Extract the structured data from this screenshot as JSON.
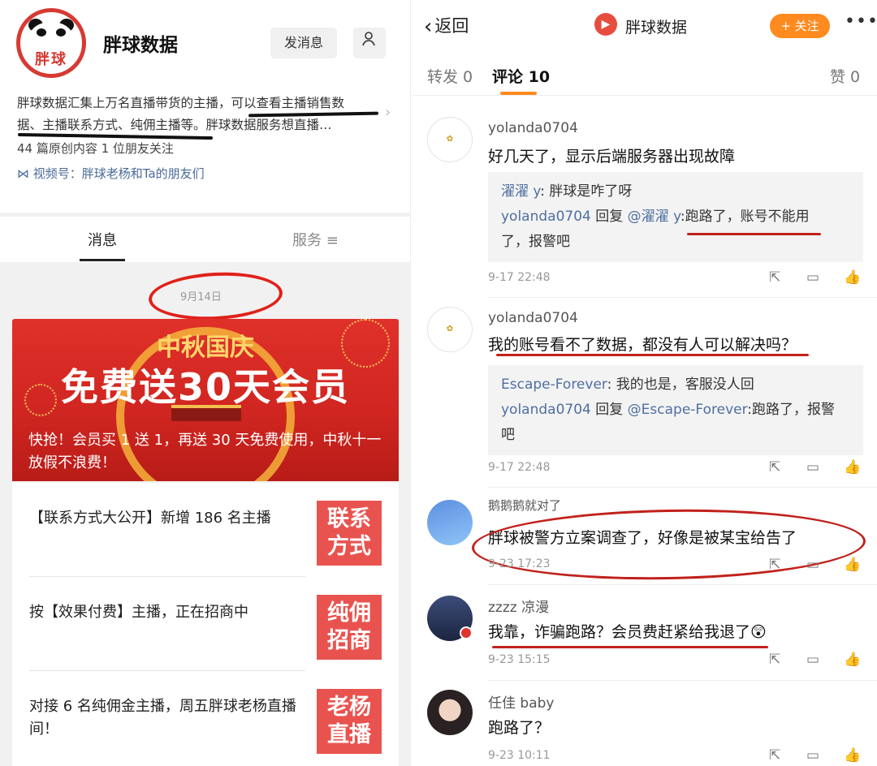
{
  "left": {
    "profile": {
      "logo_text": "胖球",
      "name": "胖球数据",
      "message_button": "发消息",
      "description_line1": "胖球数据汇集上万名直播带货的主播，可以查看主播销售数",
      "description_line2": "据、主播联系方式、纯佣主播等。胖球数据服务想直播…",
      "stats": "44 篇原创内容  1 位朋友关注",
      "channel": "视频号：胖球老杨和Ta的朋友们"
    },
    "tabs": {
      "messages": "消息",
      "services": "服务 ≡"
    },
    "date_label": "9月14日",
    "banner": {
      "title_top": "中秋国庆",
      "title_main": "免费送30天会员",
      "caption": "快抢！会员买 1 送 1，再送 30 天免费使用，中秋十一放假不浪费！"
    },
    "articles": [
      {
        "text": "【联系方式大公开】新增 186 名主播",
        "thumb_line1": "联系",
        "thumb_line2": "方式"
      },
      {
        "text": "按【效果付费】主播，正在招商中",
        "thumb_line1": "纯佣",
        "thumb_line2": "招商"
      },
      {
        "text": "对接 6 名纯佣金主播，周五胖球老杨直播间！",
        "thumb_line1": "老杨",
        "thumb_line2": "直播"
      }
    ]
  },
  "right": {
    "topbar": {
      "back_label": "返回",
      "account_name": "胖球数据",
      "follow_label": "+ 关注",
      "more": "•••"
    },
    "tabs": {
      "reposts": "转发 0",
      "comments": "评论 10",
      "likes": "赞 0"
    },
    "comments": [
      {
        "user": "yolanda0704",
        "body": "好几天了，显示后端服务器出现故障",
        "quote_line1_user": "濯濯 y",
        "quote_line1_text": ": 胖球是咋了呀",
        "quote_line2_user": "yolanda0704",
        "quote_line2_mid": " 回复 ",
        "quote_line2_at": "@濯濯 y",
        "quote_line2_text": ":跑路了，账号不能用",
        "quote_line3": "了，报警吧",
        "time": "9-17 22:48"
      },
      {
        "user": "yolanda0704",
        "body": "我的账号看不了数据，都没有人可以解决吗？",
        "quote_line1_user": "Escape-Forever",
        "quote_line1_text": ": 我的也是，客服没人回",
        "quote_line2_user": "yolanda0704",
        "quote_line2_mid": " 回复 ",
        "quote_line2_at": "@Escape-Forever",
        "quote_line2_text": ":跑路了，报警",
        "quote_line3": "吧",
        "time": "9-17 22:48"
      },
      {
        "user": "鹅鹅鹅就对了",
        "body": "胖球被警方立案调查了，好像是被某宝给告了",
        "time": "9-23 17:23"
      },
      {
        "user": "zzzz 凉漫",
        "body": "我靠，诈骗跑路？会员费赶紧给我退了😲",
        "time": "9-23 15:15"
      },
      {
        "user": "任佳 baby",
        "body": "跑路了？",
        "time": "9-23 10:11"
      }
    ],
    "icons": {
      "share": "⇱",
      "reply": "▭",
      "like": "👍"
    }
  },
  "colors": {
    "brand_red": "#d63a33",
    "follow_orange": "#ff8a1f",
    "annotation_red": "#c1211b",
    "link_blue": "#4f6fa0"
  }
}
